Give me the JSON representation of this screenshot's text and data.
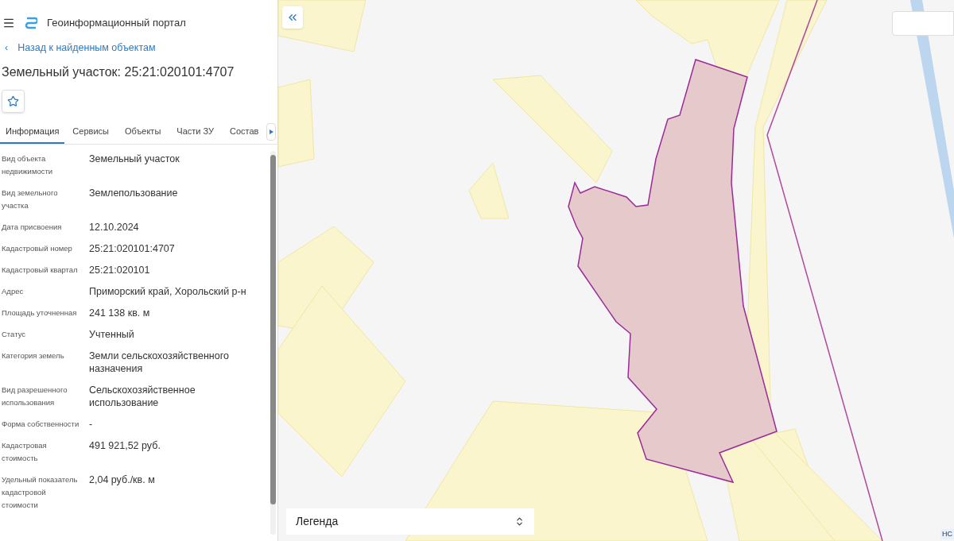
{
  "header": {
    "title": "Геоинформационный портал"
  },
  "back_link": {
    "icon": "‹",
    "label": "Назад к найденным объектам"
  },
  "object_title": "Земельный участок: 25:21:020101:4707",
  "favorite": {
    "on": false
  },
  "tabs": [
    {
      "label": "Информация",
      "selected": true
    },
    {
      "label": "Сервисы",
      "selected": false
    },
    {
      "label": "Объекты",
      "selected": false
    },
    {
      "label": "Части ЗУ",
      "selected": false
    },
    {
      "label": "Состав",
      "selected": false
    }
  ],
  "attributes": [
    {
      "label": "Вид объекта недвижимости",
      "value": "Земельный участок"
    },
    {
      "label": "Вид земельного участка",
      "value": "Землепользование"
    },
    {
      "label": "Дата присвоения",
      "value": "12.10.2024"
    },
    {
      "label": "Кадастровый номер",
      "value": "25:21:020101:4707"
    },
    {
      "label": "Кадастровый квартал",
      "value": "25:21:020101"
    },
    {
      "label": "Адрес",
      "value": "Приморский край, Хорольский р-н"
    },
    {
      "label": "Площадь уточненная",
      "value": "241 138 кв. м"
    },
    {
      "label": "Статус",
      "value": "Учтенный"
    },
    {
      "label": "Категория земель",
      "value": "Земли сельскохозяйственного назначения"
    },
    {
      "label": "Вид разрешенного использования",
      "value": "Сельскохозяйственное использование"
    },
    {
      "label": "Форма собственности",
      "value": "-"
    },
    {
      "label": "Кадастровая стоимость",
      "value": "491 921,52 руб."
    },
    {
      "label": "Удельный показатель кадастровой стоимости",
      "value": "2,04 руб./кв. м"
    }
  ],
  "map": {
    "legend": {
      "label": "Легенда"
    },
    "attribution": "НС"
  }
}
